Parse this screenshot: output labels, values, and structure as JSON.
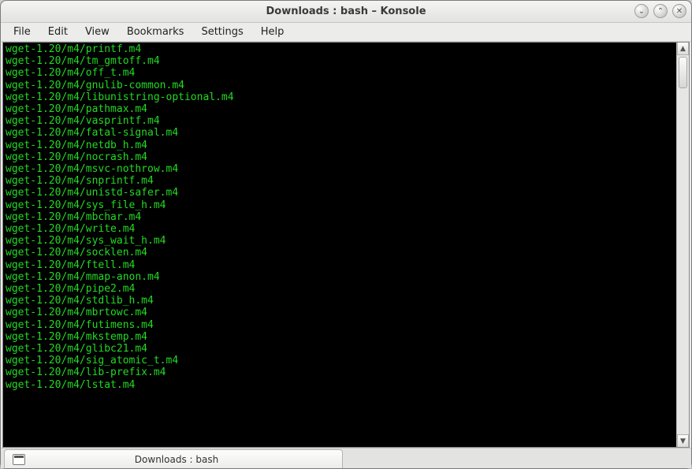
{
  "window": {
    "title": "Downloads : bash – Konsole"
  },
  "menubar": {
    "items": [
      "File",
      "Edit",
      "View",
      "Bookmarks",
      "Settings",
      "Help"
    ]
  },
  "terminal": {
    "lines": [
      "wget-1.20/m4/printf.m4",
      "wget-1.20/m4/tm_gmtoff.m4",
      "wget-1.20/m4/off_t.m4",
      "wget-1.20/m4/gnulib-common.m4",
      "wget-1.20/m4/libunistring-optional.m4",
      "wget-1.20/m4/pathmax.m4",
      "wget-1.20/m4/vasprintf.m4",
      "wget-1.20/m4/fatal-signal.m4",
      "wget-1.20/m4/netdb_h.m4",
      "wget-1.20/m4/nocrash.m4",
      "wget-1.20/m4/msvc-nothrow.m4",
      "wget-1.20/m4/snprintf.m4",
      "wget-1.20/m4/unistd-safer.m4",
      "wget-1.20/m4/sys_file_h.m4",
      "wget-1.20/m4/mbchar.m4",
      "wget-1.20/m4/write.m4",
      "wget-1.20/m4/sys_wait_h.m4",
      "wget-1.20/m4/socklen.m4",
      "wget-1.20/m4/ftell.m4",
      "wget-1.20/m4/mmap-anon.m4",
      "wget-1.20/m4/pipe2.m4",
      "wget-1.20/m4/stdlib_h.m4",
      "wget-1.20/m4/mbrtowc.m4",
      "wget-1.20/m4/futimens.m4",
      "wget-1.20/m4/mkstemp.m4",
      "wget-1.20/m4/glibc21.m4",
      "wget-1.20/m4/sig_atomic_t.m4",
      "wget-1.20/m4/lib-prefix.m4",
      "wget-1.20/m4/lstat.m4"
    ]
  },
  "tabs": {
    "active_label": "Downloads : bash"
  },
  "title_buttons": {
    "minimize_glyph": "⌄",
    "maximize_glyph": "⌃",
    "close_glyph": "✕"
  },
  "scrollbar": {
    "up_glyph": "▲",
    "down_glyph": "▼"
  }
}
